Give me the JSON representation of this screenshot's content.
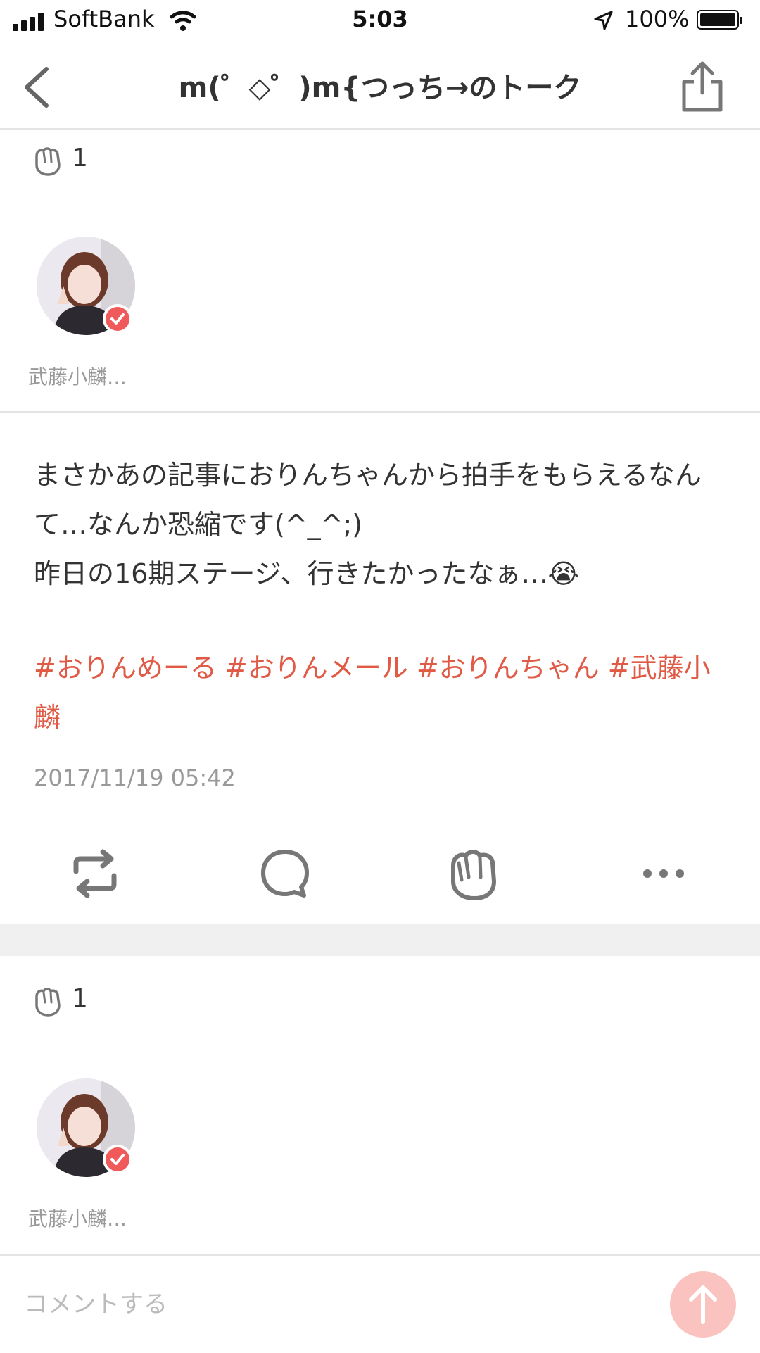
{
  "status_bar": {
    "carrier": "SoftBank",
    "time": "5:03",
    "battery": "100%"
  },
  "header": {
    "title": "m(゜◇゜)m{つっち→のトーク",
    "back_icon": "chevron-left-icon",
    "share_icon": "share-icon"
  },
  "posts": [
    {
      "clap_count": "1",
      "author_name": "武藤小麟…"
    },
    {
      "text": "まさかあの記事におりんちゃんから拍手をもらえるなんて…なんか恐縮です(^_^;)\n昨日の16期ステージ、行きたかったなぁ…😭",
      "hashtags": "#おりんめーる #おりんメール #おりんちゃん #武藤小麟",
      "timestamp": "2017/11/19 05:42",
      "clap_count": "1",
      "author_name": "武藤小麟…"
    }
  ],
  "actions": [
    "repost-icon",
    "comment-icon",
    "clap-icon",
    "more-icon"
  ],
  "comment_bar": {
    "placeholder": "コメントする"
  },
  "colors": {
    "accent": "#e05a45",
    "badge": "#f15a5a",
    "send_button": "#fbc3c0"
  }
}
